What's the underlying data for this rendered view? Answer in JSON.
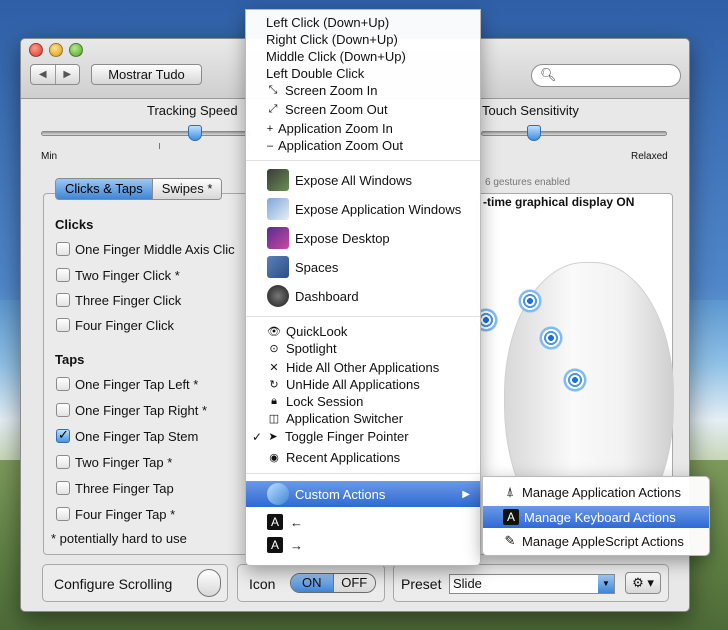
{
  "window": {
    "show_all_label": "Mostrar Tudo",
    "nav_back": "◀",
    "nav_forward": "▶"
  },
  "sliders": {
    "tracking_label": "Tracking Speed",
    "touch_label": "Touch Sensitivity",
    "min_label": "Min",
    "relaxed_label": "Relaxed"
  },
  "tabs": [
    "Clicks & Taps",
    "Swipes *"
  ],
  "gestures_enabled": "6 gestures enabled",
  "display_status": "-time graphical display ON",
  "clicks": {
    "heading": "Clicks",
    "items": [
      {
        "label": "One Finger Middle Axis Clic",
        "checked": false
      },
      {
        "label": "Two Finger Click *",
        "checked": false
      },
      {
        "label": "Three Finger Click",
        "checked": false
      },
      {
        "label": "Four Finger Click",
        "checked": false
      }
    ]
  },
  "taps": {
    "heading": "Taps",
    "items": [
      {
        "label": "One Finger Tap Left *",
        "checked": false
      },
      {
        "label": "One Finger Tap Right *",
        "checked": false
      },
      {
        "label": "One Finger Tap  Stem",
        "checked": true
      },
      {
        "label": "Two Finger Tap *",
        "checked": false
      },
      {
        "label": "Three Finger Tap",
        "checked": false
      },
      {
        "label": "Four Finger Tap *",
        "checked": false
      }
    ]
  },
  "footnote": "* potentially hard to use",
  "bottom": {
    "configure_scrolling": "Configure Scrolling",
    "icon_label": "Icon",
    "on": "ON",
    "off": "OFF",
    "preset_label": "Preset",
    "preset_value": "Slide"
  },
  "menu": {
    "items": [
      "Left Click (Down+Up)",
      "Right Click (Down+Up)",
      "Middle Click (Down+Up)",
      "Left Double Click",
      "Screen Zoom In",
      "Screen Zoom Out",
      "Application Zoom In",
      "Application Zoom Out",
      "Expose All Windows",
      "Expose Application Windows",
      "Expose Desktop",
      "Spaces",
      "Dashboard",
      "QuickLook",
      "Spotlight",
      "Hide All Other Applications",
      "UnHide All Applications",
      "Lock Session",
      "Application Switcher",
      "Toggle Finger Pointer",
      "Recent Applications",
      "Custom Actions",
      "←",
      "→"
    ],
    "checked_item": "Toggle Finger Pointer",
    "highlighted_item": "Custom Actions"
  },
  "submenu": {
    "items": [
      "Manage Application Actions",
      "Manage Keyboard Actions",
      "Manage AppleScript Actions"
    ],
    "highlighted_item": "Manage Keyboard Actions"
  },
  "colors": {
    "highlight": "#3a74d8",
    "accent_blue": "#3f85d6"
  }
}
